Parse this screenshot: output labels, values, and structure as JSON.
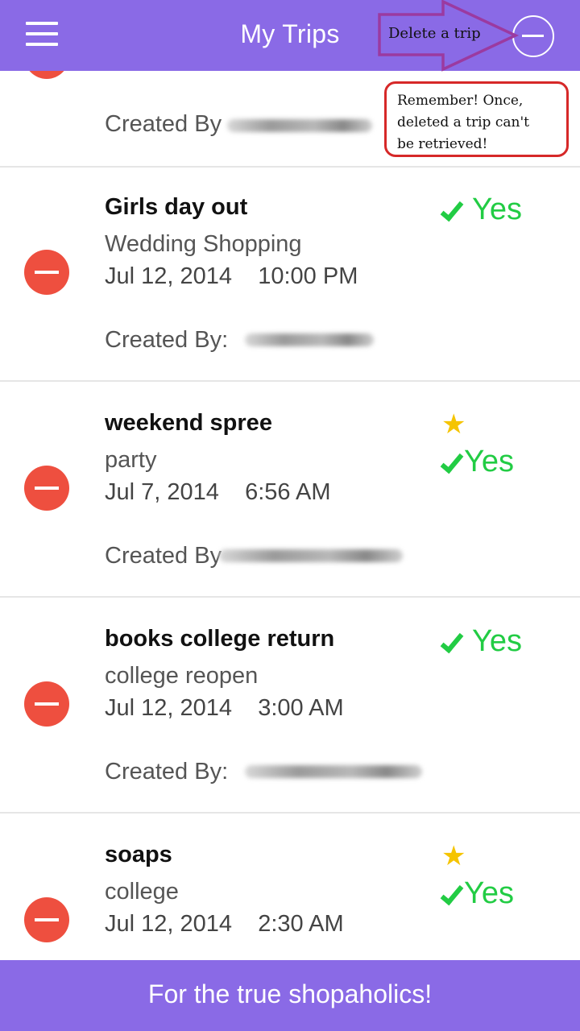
{
  "header": {
    "title": "My Trips",
    "menu_icon": "hamburger-menu-icon",
    "delete_mode_icon": "minus-circle-icon"
  },
  "annotation": {
    "arrow_label": "Delete a trip",
    "callout_lines": [
      "Remember! Once,",
      "deleted a trip can't",
      "be retrieved!"
    ],
    "callout_border_color": "#d62828",
    "arrow_color": "#9b3aa0"
  },
  "trips": [
    {
      "name": "",
      "purpose": "",
      "date": "",
      "created_by_label": "Created By",
      "starred": false,
      "status": ""
    },
    {
      "name": "Girls day out",
      "purpose": "Wedding Shopping",
      "date": "Jul 12, 2014    10:00 PM",
      "created_by_label": "Created By:",
      "starred": false,
      "status": "Yes"
    },
    {
      "name": "weekend spree",
      "purpose": "party",
      "date": "Jul 7, 2014    6:56 AM",
      "created_by_label": "Created By",
      "starred": true,
      "status": "Yes"
    },
    {
      "name": "books college return",
      "purpose": "college reopen",
      "date": "Jul 12, 2014    3:00 AM",
      "created_by_label": "Created By:",
      "starred": false,
      "status": "Yes"
    },
    {
      "name": "soaps",
      "purpose": "college",
      "date": "Jul 12, 2014    2:30 AM",
      "created_by_label": "",
      "starred": true,
      "status": "Yes"
    }
  ],
  "footer": {
    "text": "For the true shopaholics!"
  },
  "colors": {
    "bar": "#8a6ae6",
    "delete": "#ee4f3f",
    "status_green": "#22cc44",
    "star": "#f5c400"
  }
}
